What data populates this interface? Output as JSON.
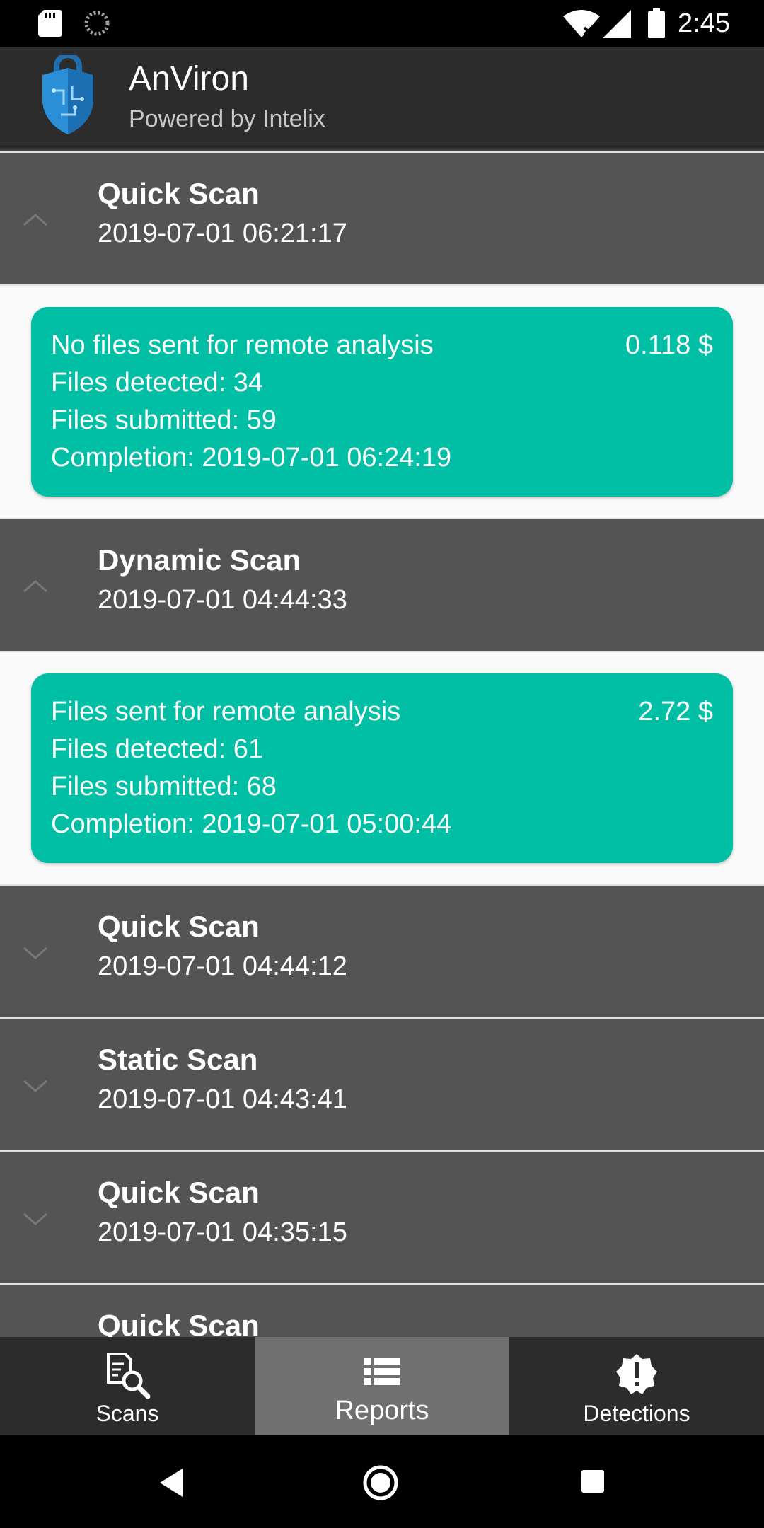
{
  "status_bar": {
    "time": "2:45",
    "icons": [
      "sd-card-icon",
      "sync-spinner-icon",
      "wifi-icon",
      "signal-icon",
      "battery-icon"
    ]
  },
  "app_bar": {
    "title": "AnViron",
    "subtitle": "Powered by Intelix",
    "logo": "shield-lock-logo"
  },
  "scans": [
    {
      "name": "Quick Scan",
      "time": "2019-07-01 06:21:17",
      "expanded": true,
      "detail": {
        "status": "No files sent for remote analysis",
        "cost": "0.118 $",
        "files_detected": "Files detected: 34",
        "files_submitted": "Files submitted: 59",
        "completion": "Completion: 2019-07-01 06:24:19"
      }
    },
    {
      "name": "Dynamic Scan",
      "time": "2019-07-01 04:44:33",
      "expanded": true,
      "detail": {
        "status": "Files sent for remote analysis",
        "cost": "2.72 $",
        "files_detected": "Files detected: 61",
        "files_submitted": "Files submitted: 68",
        "completion": "Completion: 2019-07-01 05:00:44"
      }
    },
    {
      "name": "Quick Scan",
      "time": "2019-07-01 04:44:12",
      "expanded": false
    },
    {
      "name": "Static Scan",
      "time": "2019-07-01 04:43:41",
      "expanded": false
    },
    {
      "name": "Quick Scan",
      "time": "2019-07-01 04:35:15",
      "expanded": false
    },
    {
      "name": "Quick Scan",
      "time": "",
      "expanded": false
    }
  ],
  "bottom_nav": {
    "tabs": [
      {
        "label": "Scans",
        "icon": "scan-search-icon",
        "active": false
      },
      {
        "label": "Reports",
        "icon": "list-icon",
        "active": true
      },
      {
        "label": "Detections",
        "icon": "alert-badge-icon",
        "active": false
      }
    ]
  },
  "colors": {
    "card": "#00bfa5",
    "header_bg": "#545454",
    "app_bar": "#2c2c2c",
    "active_tab": "#707070"
  }
}
